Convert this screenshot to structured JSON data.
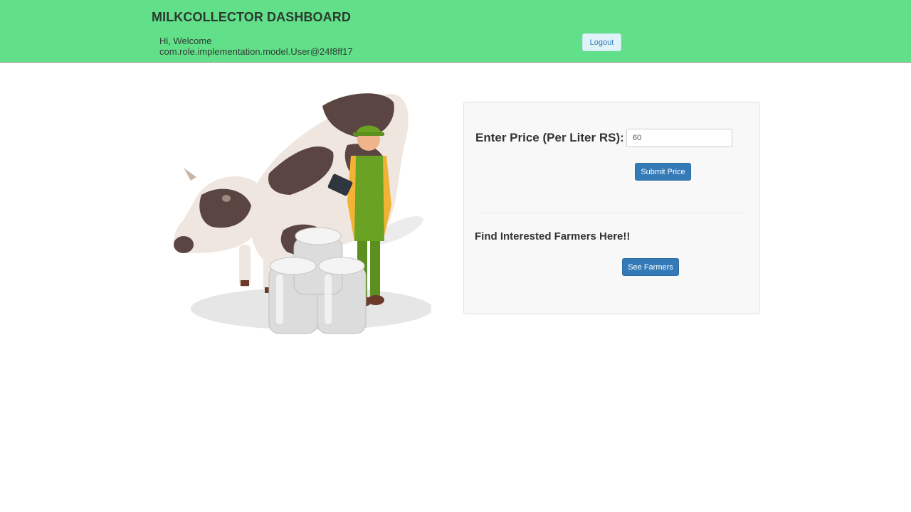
{
  "header": {
    "title": "MILKCOLLECTOR DASHBOARD",
    "welcome_line1": "Hi, Welcome",
    "welcome_line2": "com.role.implementation.model.User@24f8ff17",
    "logout_label": "Logout"
  },
  "price_form": {
    "label": "Enter Price (Per Liter RS):",
    "value": "60",
    "submit_label": "Submit Price"
  },
  "farmers": {
    "heading": "Find Interested Farmers Here!!",
    "button_label": "See Farmers"
  },
  "colors": {
    "header_bg": "#62e089",
    "primary_button": "#337ab7",
    "panel_bg": "#f8f8f8"
  },
  "hero_image": "cow-farmer-milk-cans-illustration"
}
